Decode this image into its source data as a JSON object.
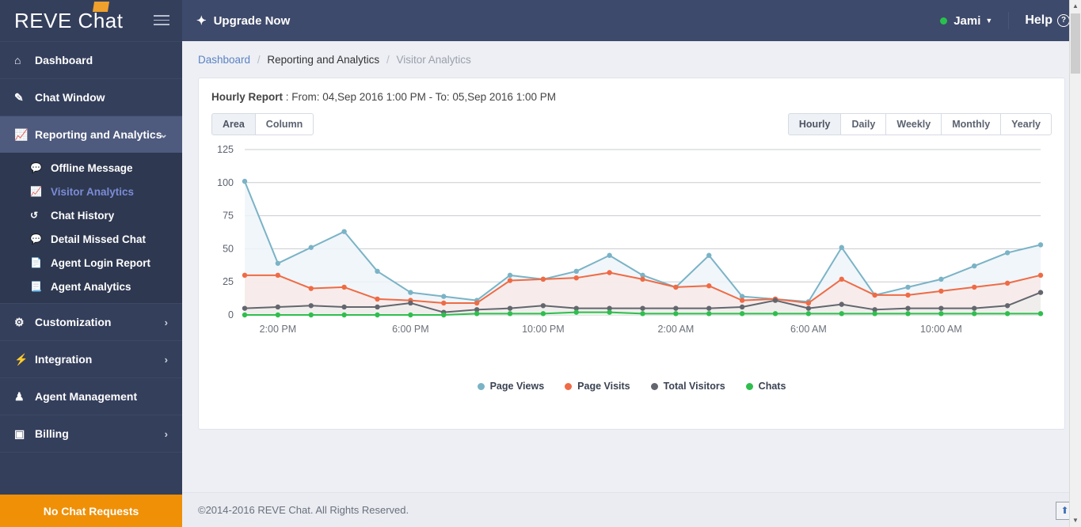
{
  "brand": {
    "name_part1": "REVE",
    "name_part2": "Chat",
    "menu_icon": "hamburger-icon"
  },
  "sidebar": {
    "items": [
      {
        "label": "Dashboard",
        "icon": "home-icon",
        "glyph": "⌂"
      },
      {
        "label": "Chat Window",
        "icon": "compose-icon",
        "glyph": "✎"
      },
      {
        "label": "Reporting and Analytics",
        "icon": "bar-chart-icon",
        "glyph": "▐",
        "caret": "⌄",
        "active": true
      }
    ],
    "subitems": [
      {
        "label": "Offline Message",
        "icon": "chat-bubble-icon",
        "glyph": "💬"
      },
      {
        "label": "Visitor Analytics",
        "icon": "bar-chart-icon",
        "glyph": "▐",
        "current": true
      },
      {
        "label": "Chat History",
        "icon": "history-icon",
        "glyph": "↺"
      },
      {
        "label": "Detail Missed Chat",
        "icon": "chat-bubble-icon",
        "glyph": "💬"
      },
      {
        "label": "Agent Login Report",
        "icon": "file-icon",
        "glyph": "📄"
      },
      {
        "label": "Agent Analytics",
        "icon": "file-lines-icon",
        "glyph": "📃"
      }
    ],
    "items_bottom": [
      {
        "label": "Customization",
        "icon": "gear-icon",
        "glyph": "⚙",
        "caret": "›"
      },
      {
        "label": "Integration",
        "icon": "plug-icon",
        "glyph": "⚡",
        "caret": "›"
      },
      {
        "label": "Agent Management",
        "icon": "user-icon",
        "glyph": "♟",
        "caret": ""
      },
      {
        "label": "Billing",
        "icon": "card-icon",
        "glyph": "▣",
        "caret": "›"
      }
    ],
    "chat_requests": "No Chat Requests"
  },
  "topbar": {
    "upgrade_label": "Upgrade Now",
    "upgrade_icon": "magic-wand-icon",
    "user_name": "Jami",
    "user_status_color": "#27c24c",
    "help_label": "Help",
    "help_icon": "question-circle-icon"
  },
  "breadcrumb": {
    "root": "Dashboard",
    "section": "Reporting and Analytics",
    "current": "Visitor Analytics",
    "separator": "/"
  },
  "report": {
    "title_label": "Hourly Report",
    "title_detail": " : From: 04,Sep 2016 1:00 PM - To: 05,Sep 2016 1:00 PM",
    "chart_type_buttons": [
      {
        "label": "Area",
        "selected": true
      },
      {
        "label": "Column",
        "selected": false
      }
    ],
    "period_buttons": [
      {
        "label": "Hourly",
        "selected": true
      },
      {
        "label": "Daily",
        "selected": false
      },
      {
        "label": "Weekly",
        "selected": false
      },
      {
        "label": "Monthly",
        "selected": false
      },
      {
        "label": "Yearly",
        "selected": false
      }
    ]
  },
  "chart_data": {
    "type": "area",
    "title": "Hourly Report : From: 04,Sep 2016 1:00 PM - To: 05,Sep 2016 1:00 PM",
    "xlabel": "",
    "ylabel": "",
    "ylim": [
      0,
      125
    ],
    "yticks": [
      0,
      25,
      50,
      75,
      100,
      125
    ],
    "grid": true,
    "legend_position": "bottom",
    "x": [
      "1:00 PM",
      "2:00 PM",
      "3:00 PM",
      "4:00 PM",
      "5:00 PM",
      "6:00 PM",
      "7:00 PM",
      "8:00 PM",
      "9:00 PM",
      "10:00 PM",
      "11:00 PM",
      "12:00 AM",
      "1:00 AM",
      "2:00 AM",
      "3:00 AM",
      "4:00 AM",
      "5:00 AM",
      "6:00 AM",
      "7:00 AM",
      "8:00 AM",
      "9:00 AM",
      "10:00 AM",
      "11:00 AM",
      "12:00 PM",
      "1:00 PM"
    ],
    "xtick_labels": [
      "2:00 PM",
      "6:00 PM",
      "10:00 PM",
      "2:00 AM",
      "6:00 AM",
      "10:00 AM"
    ],
    "xtick_indices": [
      1,
      5,
      9,
      13,
      17,
      21
    ],
    "series": [
      {
        "name": "Page Views",
        "color": "#7ab3c6",
        "fill": "#eef5f9",
        "values": [
          101,
          39,
          51,
          63,
          33,
          17,
          14,
          11,
          30,
          27,
          33,
          45,
          30,
          21,
          45,
          14,
          12,
          10,
          51,
          15,
          21,
          27,
          37,
          47,
          53
        ]
      },
      {
        "name": "Page Visits",
        "color": "#ef6b45",
        "fill": "#f8eae7",
        "values": [
          30,
          30,
          20,
          21,
          12,
          11,
          9,
          9,
          26,
          27,
          28,
          32,
          27,
          21,
          22,
          11,
          12,
          9,
          27,
          15,
          15,
          18,
          21,
          24,
          30
        ]
      },
      {
        "name": "Total Visitors",
        "color": "#63666e",
        "fill": "#efeeec",
        "values": [
          5,
          6,
          7,
          6,
          6,
          9,
          2,
          4,
          5,
          7,
          5,
          5,
          5,
          5,
          5,
          6,
          11,
          5,
          8,
          4,
          5,
          5,
          5,
          7,
          17
        ]
      },
      {
        "name": "Chats",
        "color": "#2fbe4e",
        "fill": "#eaf6e9",
        "values": [
          0,
          0,
          0,
          0,
          0,
          0,
          0,
          1,
          1,
          1,
          2,
          2,
          1,
          1,
          1,
          1,
          1,
          1,
          1,
          1,
          1,
          1,
          1,
          1,
          1
        ]
      }
    ]
  },
  "footer": {
    "copyright": "©2014-2016 REVE Chat. All Rights Reserved.",
    "to_top_icon": "arrow-up-icon"
  },
  "scrollbar": {
    "up_icon": "caret-up-icon",
    "down_icon": "caret-down-icon"
  }
}
